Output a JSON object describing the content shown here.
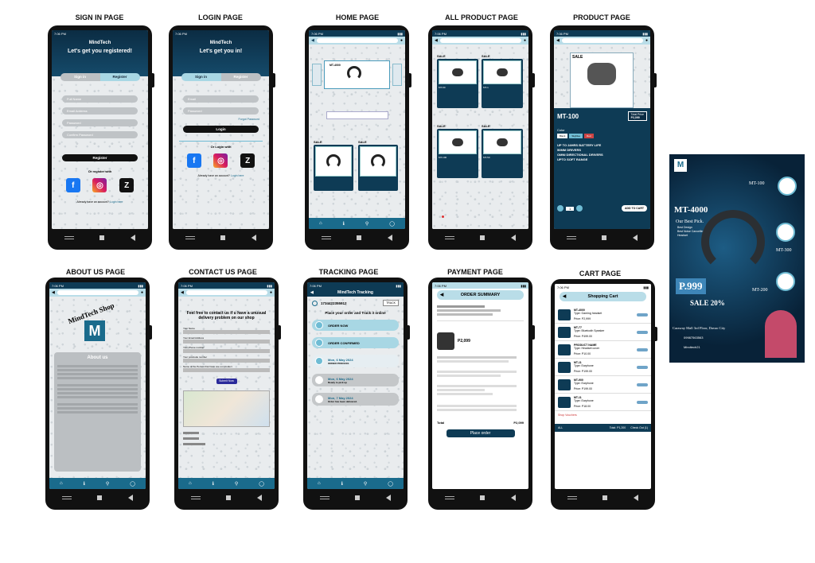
{
  "labels": {
    "signin": "SIGN IN PAGE",
    "login": "LOGIN PAGE",
    "home": "HOME PAGE",
    "allproduct": "ALL PRODUCT PAGE",
    "product": "PRODUCT PAGE",
    "about": "ABOUT US PAGE",
    "contact": "CONTACT US PAGE",
    "tracking": "TRACKING  PAGE",
    "payment": "PAYMENT PAGE",
    "cart": "CART PAGE"
  },
  "status_time": "7:06 PM",
  "brand": "MindTech",
  "signin": {
    "heading": "Let's get you registered!",
    "tab_signin": "Sign in",
    "tab_register": "Register",
    "fields": [
      "Full Name",
      "Email Address",
      "Password",
      "Confirm Password"
    ],
    "button": "Register",
    "or_text": "Or register with",
    "footer": "Already have an account?",
    "footer_link": "Login here"
  },
  "login": {
    "heading": "Let's get you in!",
    "tab_signin": "Sign in",
    "tab_register": "Register",
    "fields": [
      "Email",
      "Password"
    ],
    "forgot": "Forgot Password",
    "button": "Login",
    "or_text": "Or Login with",
    "footer": "Already have an account?",
    "footer_link": "Login here"
  },
  "home": {
    "hero_model": "MT-4000",
    "sale": "SALE"
  },
  "allproduct": {
    "sale": "SALE",
    "items": [
      "MT-90",
      "MT-1",
      "MT-100",
      "MT-50"
    ]
  },
  "product": {
    "sale": "SALE",
    "name": "MT-100",
    "total_label": "Total Price",
    "total": "P2,099",
    "color_label": "Color",
    "colors": [
      "Black",
      "Skyblue",
      "Red"
    ],
    "features": [
      "UP TO 24HRS BATTERY LIFE",
      "50MM DRIVERS",
      "OMNI DIRECTIONAL DRIVERS",
      "UPTO SOFT RANGE"
    ],
    "qty": "1",
    "add_to_cart": "ADD TO CART"
  },
  "about": {
    "title": "MindTech Shop",
    "section": "About us"
  },
  "contact": {
    "intro": "Feel free to contact us if u have a unusual delivery problem on our shop",
    "fields": [
      "Your Name",
      "Your Email Address",
      "Your Phone number",
      "Your postcode number",
      "Name of the Person that have use our product"
    ],
    "submit": "Submit Now"
  },
  "tracking": {
    "title": "MindTech Tracking",
    "number": "1734422355912",
    "track_btn": "TRACK",
    "heading": "Place your order and Track it online",
    "steps": [
      {
        "title": "ORDER NOW",
        "sub": ""
      },
      {
        "title": "ORDER CONFIRMED",
        "sub": ""
      },
      {
        "title": "Mon, 6 May 2024",
        "sub": "ORDER PROCESS"
      },
      {
        "title": "Mon, 6 May 2024",
        "sub": "Ready to pick up"
      },
      {
        "title": "Mon, 7 May 2024",
        "sub": "Order has been delivered."
      }
    ]
  },
  "payment": {
    "title": "ORDER SUMMARY",
    "price": "P2,099",
    "place_order": "Place order",
    "total_label": "Total"
  },
  "cart": {
    "title": "Shopping Cart",
    "items": [
      {
        "name": "MT-4000",
        "type": "Type: Gaming headset",
        "price": "Price: P2,999"
      },
      {
        "name": "MT-77",
        "type": "Type: Bluetooth Speaker",
        "price": "Price: P499.00"
      },
      {
        "name": "PRODUCT NAME",
        "type": "Type: Headset cover",
        "price": "Price: P10.00"
      },
      {
        "name": "MT-11",
        "type": "Type: Earphone",
        "price": "Price: P199.00"
      },
      {
        "name": "MT-900",
        "type": "Type: Earphone",
        "price": "Price: P199.00"
      },
      {
        "name": "MT-11",
        "type": "Type: Earphone",
        "price": "Price: P18.00"
      }
    ],
    "vouchers": "Shop Vouchers",
    "all": "ALL",
    "total": "Total: P1,200",
    "checkout": "Check Out (1)"
  },
  "ad": {
    "model": "MT-4000",
    "tagline": "Our Best Pick.",
    "bullets": [
      "Best Design",
      "Best Noise Cancelling",
      "Headset"
    ],
    "price": "P.999",
    "sale": "SALE 20%",
    "side_models": [
      "MT-100",
      "MT-300",
      "MT-200"
    ],
    "address": "Caraway Mall 3rd Floor, Davao City",
    "phone": "09987563563",
    "social": "Mindtech21"
  },
  "colors": {
    "navy": "#0e3b55",
    "accent": "#6fbcd4",
    "teal": "#1a6b8c"
  }
}
